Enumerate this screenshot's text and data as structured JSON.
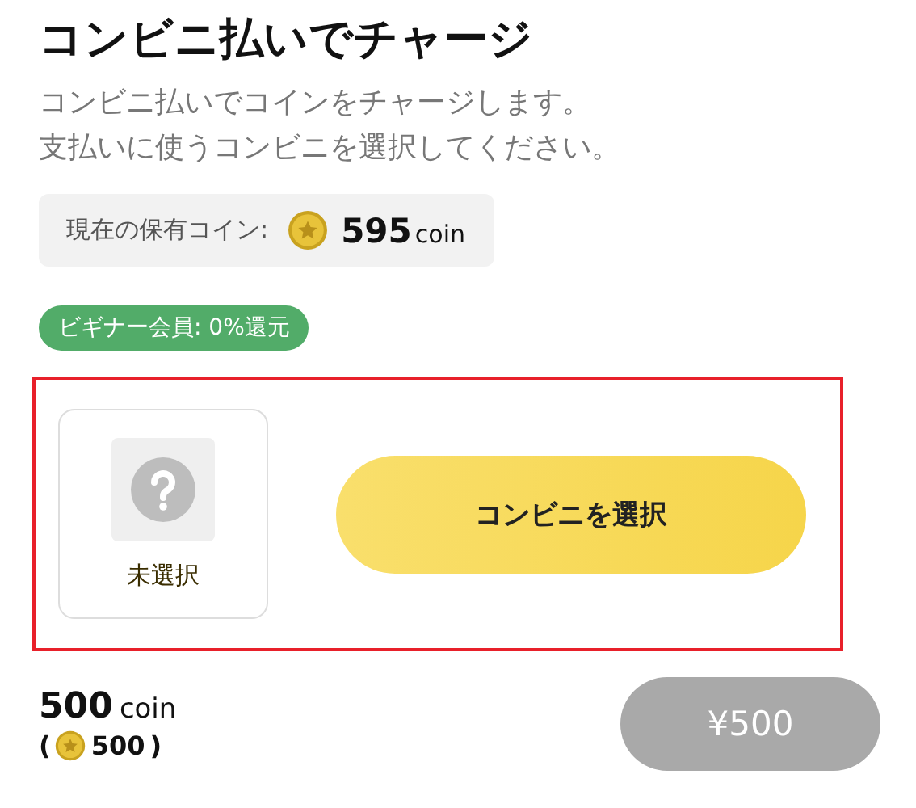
{
  "title": "コンビニ払いでチャージ",
  "description": [
    "コンビニ払いでコインをチャージします。",
    "支払いに使うコンビニを選択してください。"
  ],
  "balance": {
    "label": "現在の保有コイン:",
    "amount": "595",
    "unit": "coin"
  },
  "member_badge": {
    "label": "ビギナー会員: 0%還元"
  },
  "store_picker": {
    "highlighted": true,
    "selected_store": {
      "label": "未選択",
      "selected": false
    },
    "select_button": "コンビニを選択"
  },
  "purchase": {
    "amount": "500",
    "unit": "coin",
    "open_paren": "(",
    "coin_amount": "500",
    "close_paren": ")",
    "pay_button": {
      "label": "¥500",
      "disabled": true
    }
  }
}
